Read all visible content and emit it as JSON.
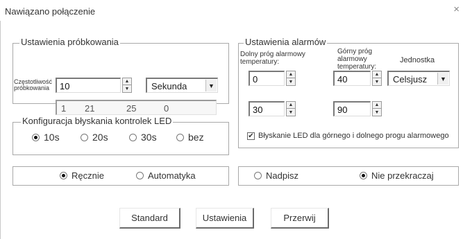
{
  "window": {
    "title": "Nawiązano połączenie",
    "close": "×"
  },
  "sampling": {
    "legend": "Ustawienia próbkowania",
    "freq_label_1": "Częstotliwość",
    "freq_label_2": "próbkowania",
    "freq_value": "10",
    "unit_selected": "Sekunda",
    "readout": [
      "1",
      "21",
      "25",
      "0"
    ]
  },
  "alarms": {
    "legend": "Ustawienia alarmów",
    "low_label_1": "Dolny próg alarmowy",
    "low_label_2": "temperatury:",
    "high_label_1": "Górny próg",
    "high_label_2": "alarmowy",
    "high_label_3": "temperatury:",
    "unit_label": "Jednostka",
    "low_temp": "0",
    "high_temp": "40",
    "unit_selected": "Celsjusz",
    "low_2": "30",
    "high_2": "90",
    "led_check_label": "Błyskanie LED dla górnego i dolnego progu alarmowego",
    "led_checked": true
  },
  "led": {
    "legend": "Konfiguracja błyskania kontrolek LED",
    "options": [
      {
        "label": "10s",
        "selected": true
      },
      {
        "label": "20s",
        "selected": false
      },
      {
        "label": "30s",
        "selected": false
      },
      {
        "label": "bez",
        "selected": false
      }
    ]
  },
  "mode": {
    "options": [
      {
        "label": "Ręcznie",
        "selected": true
      },
      {
        "label": "Automatyka",
        "selected": false
      }
    ]
  },
  "overwrite": {
    "options": [
      {
        "label": "Nadpisz",
        "selected": false
      },
      {
        "label": "Nie przekraczaj",
        "selected": true
      }
    ]
  },
  "buttons": {
    "standard": "Standard",
    "settings": "Ustawienia",
    "cancel": "Przerwij"
  }
}
